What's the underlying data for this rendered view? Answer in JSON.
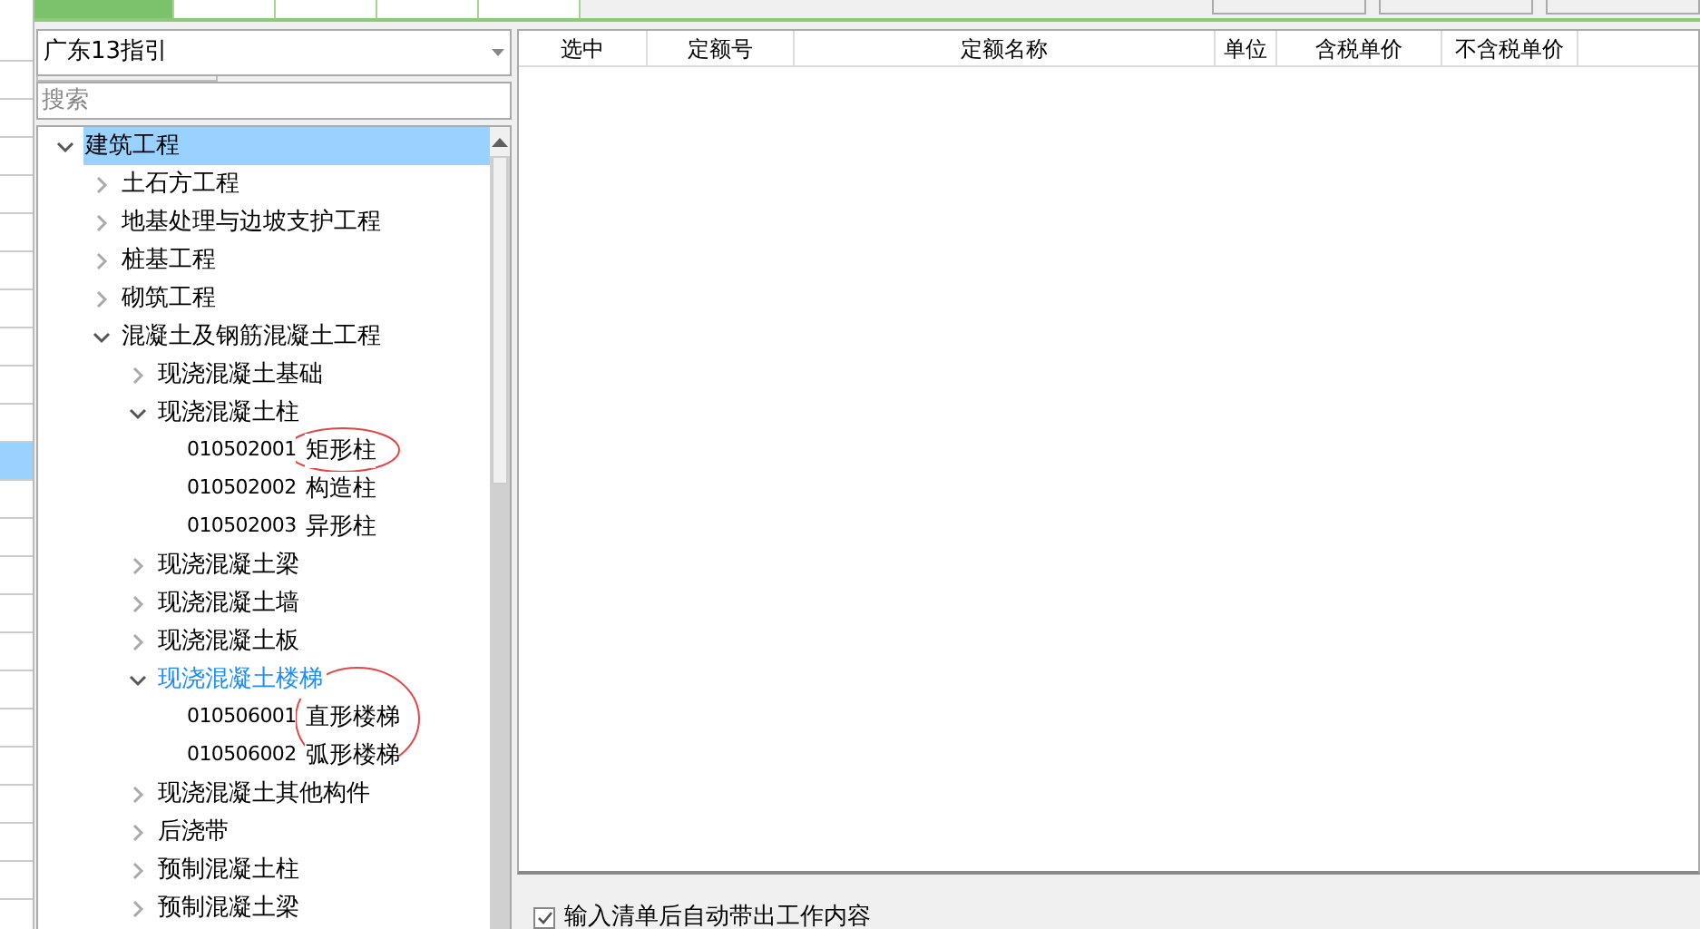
{
  "top_tabs": [
    {
      "selected": true
    },
    {
      "selected": false
    },
    {
      "selected": false
    },
    {
      "selected": false
    },
    {
      "selected": false
    }
  ],
  "left_grid": {
    "rows": [
      {
        "selected": false
      },
      {
        "selected": false
      },
      {
        "selected": false
      },
      {
        "selected": false
      },
      {
        "selected": false
      },
      {
        "selected": false
      },
      {
        "selected": false
      },
      {
        "selected": false
      },
      {
        "selected": false
      },
      {
        "selected": false
      },
      {
        "selected": false
      },
      {
        "selected": true
      },
      {
        "selected": false
      },
      {
        "selected": false
      },
      {
        "selected": false
      },
      {
        "selected": false
      },
      {
        "selected": false
      },
      {
        "selected": false
      },
      {
        "selected": false
      },
      {
        "selected": false
      },
      {
        "selected": false
      },
      {
        "selected": false
      },
      {
        "selected": false
      }
    ]
  },
  "guide": {
    "dropdown": {
      "value": "广东13指引"
    },
    "search": {
      "placeholder": "搜索"
    },
    "tree": [
      {
        "kind": "group",
        "label": "建筑工程",
        "expanded": true,
        "selected": true,
        "hot": false,
        "children": [
          {
            "kind": "group",
            "label": "土石方工程",
            "expanded": false,
            "selected": false,
            "hot": false
          },
          {
            "kind": "group",
            "label": "地基处理与边坡支护工程",
            "expanded": false,
            "selected": false,
            "hot": false
          },
          {
            "kind": "group",
            "label": "桩基工程",
            "expanded": false,
            "selected": false,
            "hot": false
          },
          {
            "kind": "group",
            "label": "砌筑工程",
            "expanded": false,
            "selected": false,
            "hot": false
          },
          {
            "kind": "group",
            "label": "混凝土及钢筋混凝土工程",
            "expanded": true,
            "selected": false,
            "hot": false,
            "children": [
              {
                "kind": "group",
                "label": "现浇混凝土基础",
                "expanded": false,
                "selected": false,
                "hot": false
              },
              {
                "kind": "group",
                "label": "现浇混凝土柱",
                "expanded": true,
                "selected": false,
                "hot": false,
                "children": [
                  {
                    "kind": "item",
                    "code": "010502001",
                    "label": "矩形柱",
                    "selected": false,
                    "hot": false
                  },
                  {
                    "kind": "item",
                    "code": "010502002",
                    "label": "构造柱",
                    "selected": false,
                    "hot": false
                  },
                  {
                    "kind": "item",
                    "code": "010502003",
                    "label": "异形柱",
                    "selected": false,
                    "hot": false
                  }
                ]
              },
              {
                "kind": "group",
                "label": "现浇混凝土梁",
                "expanded": false,
                "selected": false,
                "hot": false
              },
              {
                "kind": "group",
                "label": "现浇混凝土墙",
                "expanded": false,
                "selected": false,
                "hot": false
              },
              {
                "kind": "group",
                "label": "现浇混凝土板",
                "expanded": false,
                "selected": false,
                "hot": false
              },
              {
                "kind": "group",
                "label": "现浇混凝土楼梯",
                "expanded": true,
                "selected": false,
                "hot": true,
                "children": [
                  {
                    "kind": "item",
                    "code": "010506001",
                    "label": "直形楼梯",
                    "selected": false,
                    "hot": false
                  },
                  {
                    "kind": "item",
                    "code": "010506002",
                    "label": "弧形楼梯",
                    "selected": false,
                    "hot": false
                  }
                ]
              },
              {
                "kind": "group",
                "label": "现浇混凝土其他构件",
                "expanded": false,
                "selected": false,
                "hot": false
              },
              {
                "kind": "group",
                "label": "后浇带",
                "expanded": false,
                "selected": false,
                "hot": false
              },
              {
                "kind": "group",
                "label": "预制混凝土柱",
                "expanded": false,
                "selected": false,
                "hot": false
              },
              {
                "kind": "group",
                "label": "预制混凝土梁",
                "expanded": false,
                "selected": false,
                "hot": false
              }
            ]
          }
        ]
      }
    ]
  },
  "table": {
    "columns": [
      "选中",
      "定额号",
      "定额名称",
      "单位",
      "含税单价",
      "不含税单价"
    ]
  },
  "auto_fill": {
    "label": "输入清单后自动带出工作内容",
    "checked": true
  }
}
